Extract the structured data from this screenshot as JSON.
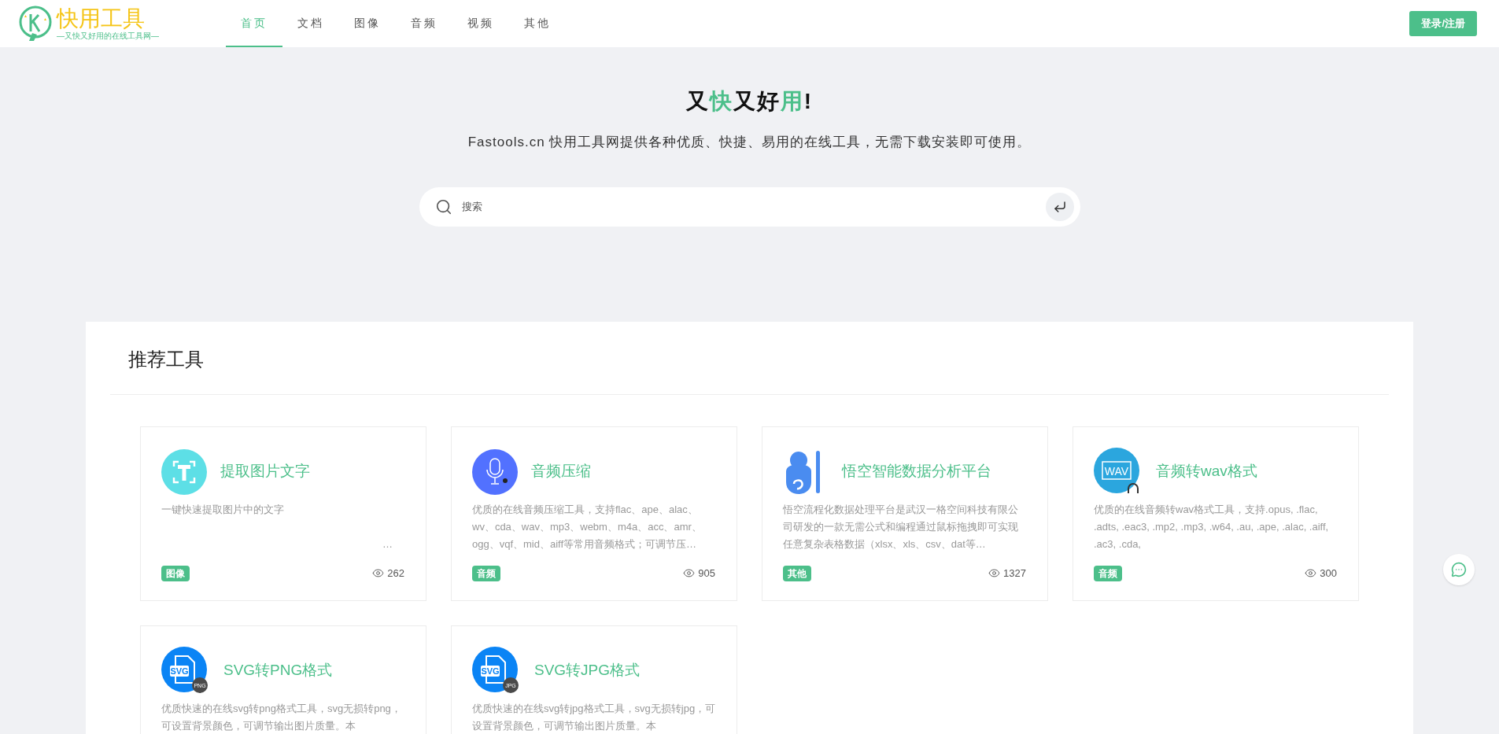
{
  "logo": {
    "name": "快用工具",
    "slogan": "—又快又好用的在线工具网—"
  },
  "nav": [
    {
      "label": "首页",
      "selected": true
    },
    {
      "label": "文档",
      "selected": false
    },
    {
      "label": "图像",
      "selected": false
    },
    {
      "label": "音频",
      "selected": false
    },
    {
      "label": "视频",
      "selected": false
    },
    {
      "label": "其他",
      "selected": false
    }
  ],
  "login_button": "登录/注册",
  "hero": {
    "headline": [
      {
        "text": "又",
        "highlight": false
      },
      {
        "text": "快",
        "highlight": true
      },
      {
        "text": "又好",
        "highlight": false
      },
      {
        "text": "用",
        "highlight": true
      },
      {
        "text": "!",
        "highlight": false
      }
    ],
    "subtitle": "Fastools.cn 快用工具网提供各种优质、快捷、易用的在线工具，无需下载安装即可使用。",
    "search": {
      "placeholder": "搜索"
    }
  },
  "section": {
    "title": "推荐工具",
    "cards": [
      {
        "kind": "text-extract",
        "title": "提取图片文字",
        "description": "一键快速提取图片中的文字",
        "overflow_mark": "…",
        "tag": "图像",
        "views": "262"
      },
      {
        "kind": "microphone",
        "title": "音频压缩",
        "description": "优质的在线音频压缩工具，支持flac、ape、alac、wv、cda、wav、mp3、webm、m4a、acc、amr、ogg、vqf、mid、aiff等常用音频格式；可调节压…",
        "tag": "音频",
        "views": "905"
      },
      {
        "kind": "monkey",
        "title": "悟空智能数据分析平台",
        "description": "悟空流程化数据处理平台是武汉一格空间科技有限公司研发的一款无需公式和编程通过鼠标拖拽即可实现任意复杂表格数据（xlsx、xls、csv、dat等…",
        "tag": "其他",
        "views": "1327"
      },
      {
        "kind": "wav",
        "icon_label": "WAV",
        "title": "音频转wav格式",
        "description": "优质的在线音频转wav格式工具，支持.opus, .flac, .adts, .eac3, .mp2, .mp3, .w64, .au, .ape, .alac, .aiff, .ac3, .cda,",
        "tag": "音频",
        "views": "300"
      },
      {
        "kind": "svg-file",
        "icon_label": "SVG",
        "icon_badge": "PNG",
        "title": "SVG转PNG格式",
        "description": "优质快速的在线svg转png格式工具，svg无损转png，可设置背景颜色，可调节输出图片质量。本"
      },
      {
        "kind": "svg-file",
        "icon_label": "SVG",
        "icon_badge": "JPG",
        "title": "SVG转JPG格式",
        "description": "优质快速的在线svg转jpg格式工具，svg无损转jpg，可设置背景颜色，可调节输出图片质量。本"
      }
    ]
  }
}
